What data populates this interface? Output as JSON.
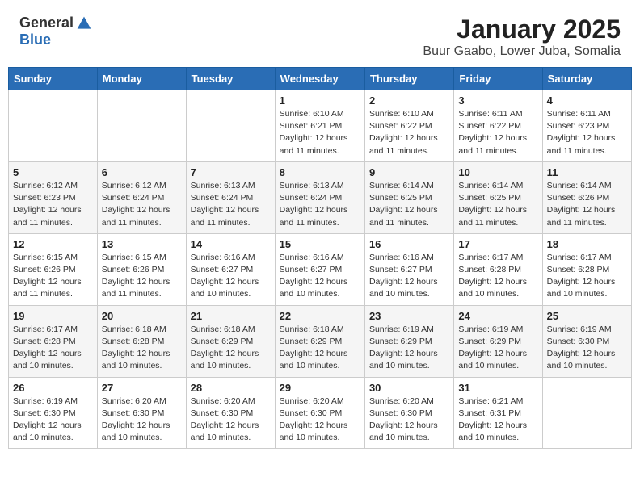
{
  "header": {
    "logo_general": "General",
    "logo_blue": "Blue",
    "month": "January 2025",
    "location": "Buur Gaabo, Lower Juba, Somalia"
  },
  "weekdays": [
    "Sunday",
    "Monday",
    "Tuesday",
    "Wednesday",
    "Thursday",
    "Friday",
    "Saturday"
  ],
  "weeks": [
    [
      {
        "day": "",
        "info": ""
      },
      {
        "day": "",
        "info": ""
      },
      {
        "day": "",
        "info": ""
      },
      {
        "day": "1",
        "info": "Sunrise: 6:10 AM\nSunset: 6:21 PM\nDaylight: 12 hours\nand 11 minutes."
      },
      {
        "day": "2",
        "info": "Sunrise: 6:10 AM\nSunset: 6:22 PM\nDaylight: 12 hours\nand 11 minutes."
      },
      {
        "day": "3",
        "info": "Sunrise: 6:11 AM\nSunset: 6:22 PM\nDaylight: 12 hours\nand 11 minutes."
      },
      {
        "day": "4",
        "info": "Sunrise: 6:11 AM\nSunset: 6:23 PM\nDaylight: 12 hours\nand 11 minutes."
      }
    ],
    [
      {
        "day": "5",
        "info": "Sunrise: 6:12 AM\nSunset: 6:23 PM\nDaylight: 12 hours\nand 11 minutes."
      },
      {
        "day": "6",
        "info": "Sunrise: 6:12 AM\nSunset: 6:24 PM\nDaylight: 12 hours\nand 11 minutes."
      },
      {
        "day": "7",
        "info": "Sunrise: 6:13 AM\nSunset: 6:24 PM\nDaylight: 12 hours\nand 11 minutes."
      },
      {
        "day": "8",
        "info": "Sunrise: 6:13 AM\nSunset: 6:24 PM\nDaylight: 12 hours\nand 11 minutes."
      },
      {
        "day": "9",
        "info": "Sunrise: 6:14 AM\nSunset: 6:25 PM\nDaylight: 12 hours\nand 11 minutes."
      },
      {
        "day": "10",
        "info": "Sunrise: 6:14 AM\nSunset: 6:25 PM\nDaylight: 12 hours\nand 11 minutes."
      },
      {
        "day": "11",
        "info": "Sunrise: 6:14 AM\nSunset: 6:26 PM\nDaylight: 12 hours\nand 11 minutes."
      }
    ],
    [
      {
        "day": "12",
        "info": "Sunrise: 6:15 AM\nSunset: 6:26 PM\nDaylight: 12 hours\nand 11 minutes."
      },
      {
        "day": "13",
        "info": "Sunrise: 6:15 AM\nSunset: 6:26 PM\nDaylight: 12 hours\nand 11 minutes."
      },
      {
        "day": "14",
        "info": "Sunrise: 6:16 AM\nSunset: 6:27 PM\nDaylight: 12 hours\nand 10 minutes."
      },
      {
        "day": "15",
        "info": "Sunrise: 6:16 AM\nSunset: 6:27 PM\nDaylight: 12 hours\nand 10 minutes."
      },
      {
        "day": "16",
        "info": "Sunrise: 6:16 AM\nSunset: 6:27 PM\nDaylight: 12 hours\nand 10 minutes."
      },
      {
        "day": "17",
        "info": "Sunrise: 6:17 AM\nSunset: 6:28 PM\nDaylight: 12 hours\nand 10 minutes."
      },
      {
        "day": "18",
        "info": "Sunrise: 6:17 AM\nSunset: 6:28 PM\nDaylight: 12 hours\nand 10 minutes."
      }
    ],
    [
      {
        "day": "19",
        "info": "Sunrise: 6:17 AM\nSunset: 6:28 PM\nDaylight: 12 hours\nand 10 minutes."
      },
      {
        "day": "20",
        "info": "Sunrise: 6:18 AM\nSunset: 6:28 PM\nDaylight: 12 hours\nand 10 minutes."
      },
      {
        "day": "21",
        "info": "Sunrise: 6:18 AM\nSunset: 6:29 PM\nDaylight: 12 hours\nand 10 minutes."
      },
      {
        "day": "22",
        "info": "Sunrise: 6:18 AM\nSunset: 6:29 PM\nDaylight: 12 hours\nand 10 minutes."
      },
      {
        "day": "23",
        "info": "Sunrise: 6:19 AM\nSunset: 6:29 PM\nDaylight: 12 hours\nand 10 minutes."
      },
      {
        "day": "24",
        "info": "Sunrise: 6:19 AM\nSunset: 6:29 PM\nDaylight: 12 hours\nand 10 minutes."
      },
      {
        "day": "25",
        "info": "Sunrise: 6:19 AM\nSunset: 6:30 PM\nDaylight: 12 hours\nand 10 minutes."
      }
    ],
    [
      {
        "day": "26",
        "info": "Sunrise: 6:19 AM\nSunset: 6:30 PM\nDaylight: 12 hours\nand 10 minutes."
      },
      {
        "day": "27",
        "info": "Sunrise: 6:20 AM\nSunset: 6:30 PM\nDaylight: 12 hours\nand 10 minutes."
      },
      {
        "day": "28",
        "info": "Sunrise: 6:20 AM\nSunset: 6:30 PM\nDaylight: 12 hours\nand 10 minutes."
      },
      {
        "day": "29",
        "info": "Sunrise: 6:20 AM\nSunset: 6:30 PM\nDaylight: 12 hours\nand 10 minutes."
      },
      {
        "day": "30",
        "info": "Sunrise: 6:20 AM\nSunset: 6:30 PM\nDaylight: 12 hours\nand 10 minutes."
      },
      {
        "day": "31",
        "info": "Sunrise: 6:21 AM\nSunset: 6:31 PM\nDaylight: 12 hours\nand 10 minutes."
      },
      {
        "day": "",
        "info": ""
      }
    ]
  ]
}
